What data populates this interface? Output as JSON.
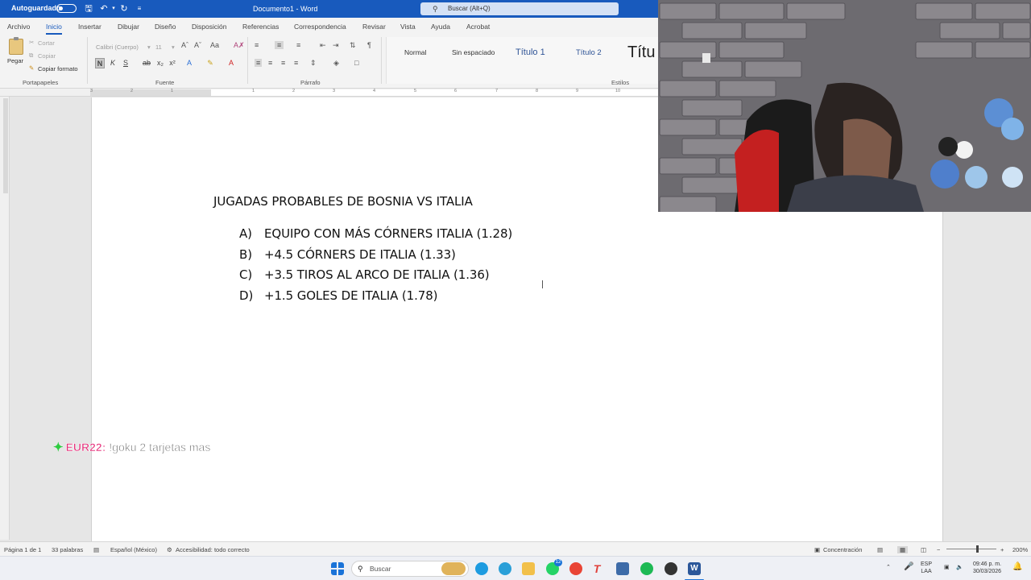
{
  "titlebar": {
    "autosave_label": "Autoguardado",
    "document_title": "Documento1 - Word",
    "search_placeholder": "Buscar (Alt+Q)"
  },
  "ribbon": {
    "tabs": [
      "Archivo",
      "Inicio",
      "Insertar",
      "Dibujar",
      "Diseño",
      "Disposición",
      "Referencias",
      "Correspondencia",
      "Revisar",
      "Vista",
      "Ayuda",
      "Acrobat"
    ],
    "active_tab": "Inicio",
    "clipboard": {
      "paste": "Pegar",
      "cut": "Cortar",
      "copy": "Copiar",
      "format_painter": "Copiar formato",
      "group": "Portapapeles"
    },
    "font": {
      "name": "Calibri (Cuerpo)",
      "size": "11",
      "group": "Fuente",
      "bold": "N",
      "italic": "K",
      "underline": "S"
    },
    "paragraph": {
      "group": "Párrafo"
    },
    "styles": {
      "items": [
        "Normal",
        "Sin espaciado",
        "Título 1",
        "Título 2",
        "Títu"
      ],
      "group": "Estilos"
    }
  },
  "ruler": {
    "ticks": [
      "3",
      "2",
      "1",
      "1",
      "2",
      "3",
      "4",
      "5",
      "6",
      "7",
      "8",
      "9",
      "10"
    ]
  },
  "document": {
    "heading": "JUGADAS PROBABLES DE BOSNIA VS ITALIA",
    "items": [
      {
        "marker": "A)",
        "text": "EQUIPO CON MÁS CÓRNERS ITALIA (1.28)"
      },
      {
        "marker": "B)",
        "text": "+4.5 CÓRNERS DE ITALIA (1.33)"
      },
      {
        "marker": "C)",
        "text": "+3.5 TIROS AL ARCO DE ITALIA (1.36)"
      },
      {
        "marker": "D)",
        "text": "+1.5 GOLES DE ITALIA (1.78)"
      }
    ]
  },
  "chat": {
    "user": "EUR22:",
    "message": "!goku 2 tarjetas mas"
  },
  "statusbar": {
    "page": "Página 1 de 1",
    "words": "33 palabras",
    "language": "Español (México)",
    "accessibility": "Accesibilidad: todo correcto",
    "focus": "Concentración",
    "zoom": "200%"
  },
  "taskbar": {
    "search_label": "Buscar",
    "whatsapp_badge": "12",
    "lang_top": "ESP",
    "lang_bottom": "LAA",
    "time": "09:46 p. m.",
    "date": "30/03/2026"
  },
  "colors": {
    "accent": "#185abd",
    "chat_user": "#e52d78",
    "chat_star": "#2ecc40"
  }
}
